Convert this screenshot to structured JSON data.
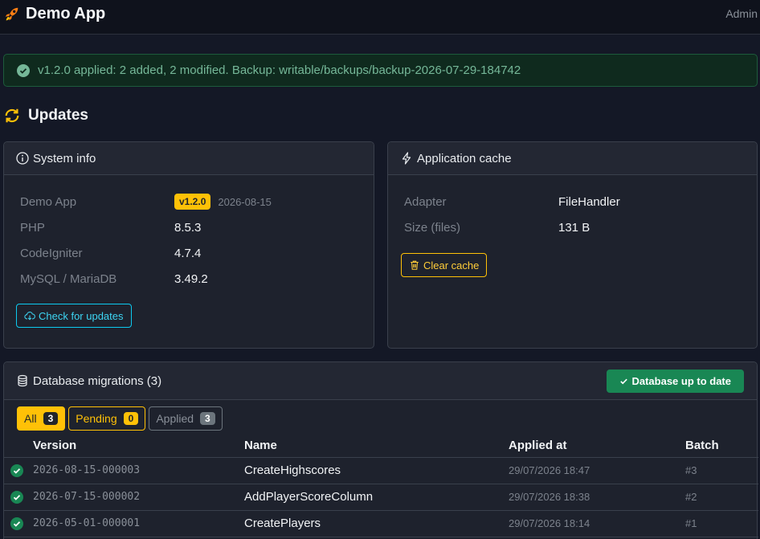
{
  "navbar": {
    "brand": "Demo App",
    "brand_icon": "rocket-icon",
    "user": "Admin"
  },
  "alert": {
    "text": "v1.2.0 applied: 2 added, 2 modified. Backup: writable/backups/backup-2026-07-29-184742",
    "color": "#75b798"
  },
  "page": {
    "title": "Updates",
    "icon": "refresh-icon"
  },
  "system_info": {
    "title": "System info",
    "rows": [
      {
        "label": "Demo App",
        "badge": "v1.2.0",
        "date": "2026-08-15"
      },
      {
        "label": "PHP",
        "value": "8.5.3"
      },
      {
        "label": "CodeIgniter",
        "value": "4.7.4"
      },
      {
        "label": "MySQL / MariaDB",
        "value": "3.49.2"
      }
    ],
    "check_button": "Check for updates"
  },
  "cache": {
    "title": "Application cache",
    "rows": [
      {
        "label": "Adapter",
        "value": "FileHandler"
      },
      {
        "label": "Size (files)",
        "value": "131 B"
      }
    ],
    "clear_button": "Clear cache"
  },
  "migrations": {
    "title": "Database migrations (3)",
    "status_button": "Database up to date",
    "filters": [
      {
        "label": "All",
        "count": "3"
      },
      {
        "label": "Pending",
        "count": "0"
      },
      {
        "label": "Applied",
        "count": "3"
      }
    ],
    "columns": [
      "Version",
      "Name",
      "Applied at",
      "Batch"
    ],
    "rows": [
      {
        "version": "2026-08-15-000003",
        "name": "CreateHighscores",
        "applied_at": "29/07/2026 18:47",
        "batch": "#3"
      },
      {
        "version": "2026-07-15-000002",
        "name": "AddPlayerScoreColumn",
        "applied_at": "29/07/2026 18:38",
        "batch": "#2"
      },
      {
        "version": "2026-05-01-000001",
        "name": "CreatePlayers",
        "applied_at": "29/07/2026 18:14",
        "batch": "#1"
      }
    ]
  },
  "colors": {
    "accent": "#ffc107",
    "success": "#198754",
    "info": "#0dcaf0",
    "background": "#141826"
  }
}
